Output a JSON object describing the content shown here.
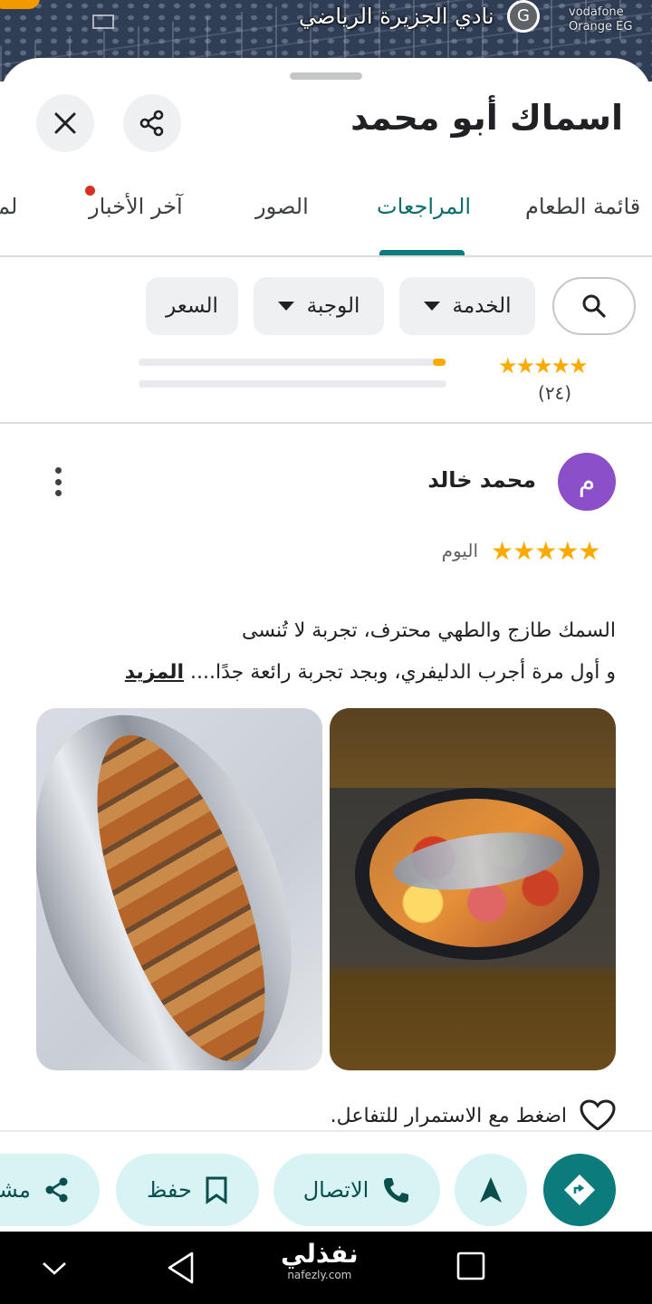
{
  "map": {
    "label": "نادي الجزيرة الرياضي",
    "pin_letter": "G",
    "brand_line1": "vodafone",
    "brand_line2": "Orange EG"
  },
  "place": {
    "title": "اسماك أبو محمد"
  },
  "tabs": [
    {
      "label": "قائمة الطعام",
      "active": false
    },
    {
      "label": "المراجعات",
      "active": true
    },
    {
      "label": "الصور",
      "active": false
    },
    {
      "label": "آخر الأخبار",
      "active": false,
      "has_dot": true
    },
    {
      "label": "لم",
      "active": false
    }
  ],
  "filters": {
    "search_icon": "search-icon",
    "chips": [
      {
        "label": "الخدمة",
        "dropdown": true
      },
      {
        "label": "الوجبة",
        "dropdown": true
      },
      {
        "label": "السعر",
        "dropdown": false
      }
    ]
  },
  "summary": {
    "stars": "★★★★★",
    "count": "(٢٤)",
    "bar_fill": 0.05
  },
  "review": {
    "avatar_letter": "م",
    "reviewer": "محمد خالد",
    "stars": "★★★★★",
    "rating": 5,
    "date": "اليوم",
    "line1": "السمك طازج والطهي محترف، تجربة لا تُنسى",
    "line2": "و أول مرة أجرب الدليفري، وبجد تجربة رائعة جدًا....",
    "more_label": "المزيد",
    "react_prompt": "اضغط مع الاستمرار للتفاعل."
  },
  "actions": {
    "directions_icon": "directions-icon",
    "start_icon": "navigation-arrow-icon",
    "call_label": "الاتصال",
    "save_label": "حفظ",
    "share_label": "مشا"
  },
  "watermark": {
    "line1": "نفذلي",
    "line2": "nafezly.com"
  },
  "colors": {
    "accent": "#0b7b7b",
    "star": "#f9ab00",
    "avatar": "#8a4fc9",
    "action_bg": "#d7f3f3"
  }
}
